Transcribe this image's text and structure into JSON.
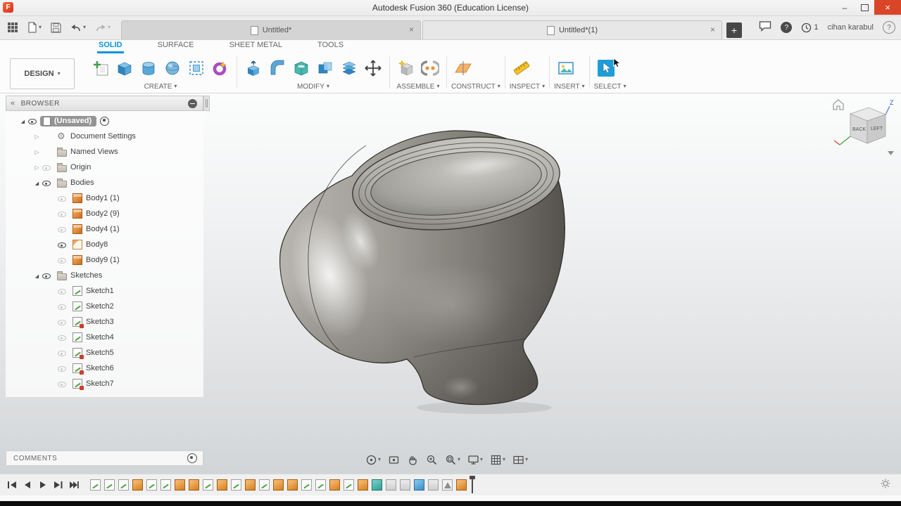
{
  "window": {
    "title": "Autodesk Fusion 360 (Education License)"
  },
  "glyphs": {
    "logo": "F",
    "minimize": "–",
    "close": "×",
    "tab_close": "×",
    "add_tab": "+",
    "caret": "▾",
    "collapse": "«",
    "help": "?"
  },
  "header": {
    "user_name": "cihan karabul",
    "job_count": "1"
  },
  "doc_tabs": [
    {
      "label": "Untitled*",
      "active": false
    },
    {
      "label": "Untitled*(1)",
      "active": true
    }
  ],
  "ribbon": {
    "workspace_label": "DESIGN",
    "tabs": [
      {
        "label": "SOLID",
        "active": true
      },
      {
        "label": "SURFACE",
        "active": false
      },
      {
        "label": "SHEET METAL",
        "active": false
      },
      {
        "label": "TOOLS",
        "active": false
      }
    ],
    "groups": {
      "create": "CREATE",
      "modify": "MODIFY",
      "assemble": "ASSEMBLE",
      "construct": "CONSTRUCT",
      "inspect": "INSPECT",
      "insert": "INSERT",
      "select": "SELECT"
    }
  },
  "browser": {
    "title": "BROWSER",
    "nodes": [
      {
        "label": "(Unsaved)",
        "icon": "document",
        "eye": "visible",
        "expander": "open",
        "indent": 0,
        "selected": true,
        "radio": true
      },
      {
        "label": "Document Settings",
        "icon": "gear",
        "eye": "none",
        "expander": "closed",
        "indent": 1
      },
      {
        "label": "Named Views",
        "icon": "folder",
        "eye": "none",
        "expander": "closed",
        "indent": 1
      },
      {
        "label": "Origin",
        "icon": "folder",
        "eye": "hidden",
        "expander": "closed",
        "indent": 1
      },
      {
        "label": "Bodies",
        "icon": "folder",
        "eye": "visible",
        "expander": "open",
        "indent": 1
      },
      {
        "label": "Body1 (1)",
        "icon": "body",
        "eye": "hidden",
        "expander": "none",
        "indent": 2
      },
      {
        "label": "Body2 (9)",
        "icon": "body",
        "eye": "hidden",
        "expander": "none",
        "indent": 2
      },
      {
        "label": "Body4 (1)",
        "icon": "body",
        "eye": "hidden",
        "expander": "none",
        "indent": 2
      },
      {
        "label": "Body8",
        "icon": "surface",
        "eye": "visible",
        "expander": "none",
        "indent": 2
      },
      {
        "label": "Body9 (1)",
        "icon": "body",
        "eye": "hidden",
        "expander": "none",
        "indent": 2
      },
      {
        "label": "Sketches",
        "icon": "folder",
        "eye": "visible",
        "expander": "open",
        "indent": 1
      },
      {
        "label": "Sketch1",
        "icon": "sketch",
        "eye": "hidden",
        "expander": "none",
        "indent": 2
      },
      {
        "label": "Sketch2",
        "icon": "sketch",
        "eye": "hidden",
        "expander": "none",
        "indent": 2
      },
      {
        "label": "Sketch3",
        "icon": "sketchlock",
        "eye": "hidden",
        "expander": "none",
        "indent": 2
      },
      {
        "label": "Sketch4",
        "icon": "sketch",
        "eye": "hidden",
        "expander": "none",
        "indent": 2
      },
      {
        "label": "Sketch5",
        "icon": "sketchlock",
        "eye": "hidden",
        "expander": "none",
        "indent": 2
      },
      {
        "label": "Sketch6",
        "icon": "sketchlock",
        "eye": "hidden",
        "expander": "none",
        "indent": 2
      },
      {
        "label": "Sketch7",
        "icon": "sketchlock",
        "eye": "hidden",
        "expander": "none",
        "indent": 2
      }
    ]
  },
  "comments": {
    "title": "COMMENTS"
  },
  "viewcube": {
    "face_left": "BACK",
    "face_right": "LEFT",
    "axis_z": "Z"
  },
  "nav_bar": {
    "icons": [
      "orbit",
      "look-at",
      "pan",
      "zoom",
      "fit",
      "display-settings",
      "grid-display",
      "viewports"
    ]
  },
  "timeline": {
    "controls": [
      "go-to-start",
      "step-back",
      "play",
      "step-forward",
      "go-to-end"
    ],
    "items": [
      {
        "type": "sketch"
      },
      {
        "type": "sketch"
      },
      {
        "type": "sketch"
      },
      {
        "type": "extrude"
      },
      {
        "type": "sketch"
      },
      {
        "type": "sketch"
      },
      {
        "type": "extrude"
      },
      {
        "type": "extrude"
      },
      {
        "type": "sketch"
      },
      {
        "type": "extrude"
      },
      {
        "type": "sketch"
      },
      {
        "type": "extrude"
      },
      {
        "type": "sketch"
      },
      {
        "type": "extrude"
      },
      {
        "type": "extrude"
      },
      {
        "type": "sketch"
      },
      {
        "type": "sketch"
      },
      {
        "type": "extrude"
      },
      {
        "type": "sketch"
      },
      {
        "type": "extrude"
      },
      {
        "type": "sweep"
      },
      {
        "type": "box"
      },
      {
        "type": "box"
      },
      {
        "type": "fillet"
      },
      {
        "type": "box"
      },
      {
        "type": "cone"
      },
      {
        "type": "extrude"
      }
    ]
  },
  "colors": {
    "accent_blue": "#0696d7",
    "select_blue": "#1f9dd9",
    "close_red": "#da4528",
    "body_orange": "#d07722"
  }
}
